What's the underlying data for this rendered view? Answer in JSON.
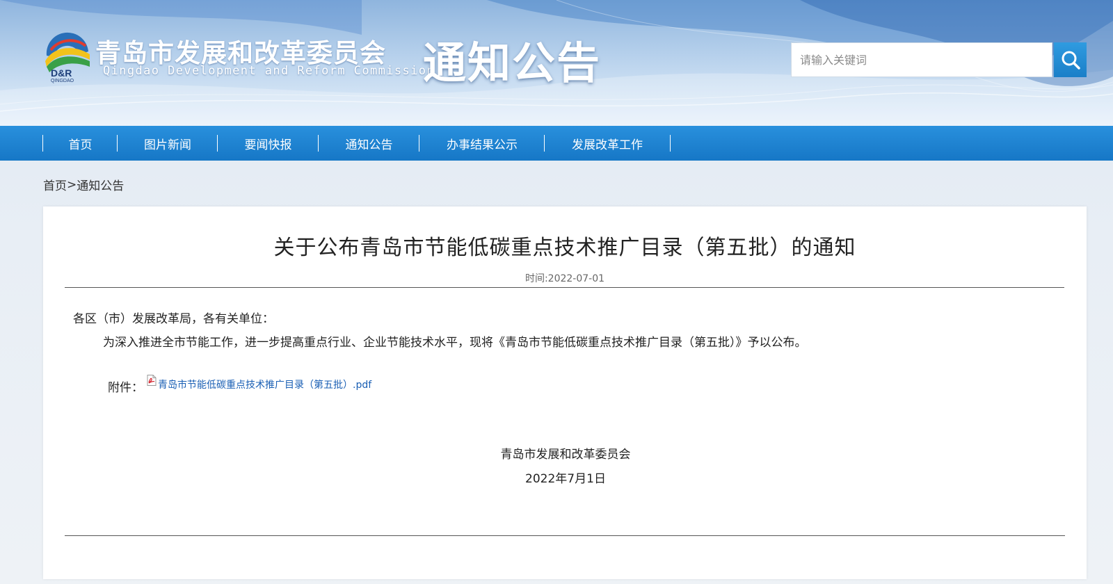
{
  "header": {
    "logo_cn": "青岛市发展和改革委员会",
    "logo_en": "Qingdao Development and Reform Commission",
    "logo_mark_text": "D&R",
    "logo_mark_subtext": "QINGDAO",
    "section_title": "通知公告",
    "search": {
      "placeholder": "请输入关键词",
      "icon": "search-icon"
    }
  },
  "nav": {
    "items": [
      {
        "label": "首页"
      },
      {
        "label": "图片新闻"
      },
      {
        "label": "要闻快报"
      },
      {
        "label": "通知公告"
      },
      {
        "label": "办事结果公示"
      },
      {
        "label": "发展改革工作"
      }
    ]
  },
  "breadcrumb": {
    "home": "首页",
    "separator": ">",
    "current": "通知公告"
  },
  "article": {
    "title": "关于公布青岛市节能低碳重点技术推广目录（第五批）的通知",
    "date": "时间:2022-07-01",
    "salutation": "各区（市）发展改革局，各有关单位：",
    "paragraph": "为深入推进全市节能工作，进一步提高重点行业、企业节能技术水平，现将《青岛市节能低碳重点技术推广目录（第五批）》予以公布。",
    "attachment_label": "附件：",
    "attachment_link": "青岛市节能低碳重点技术推广目录（第五批）.pdf",
    "attachment_icon": "pdf-icon",
    "signature_org": "青岛市发展和改革委员会",
    "signature_date": "2022年7月1日"
  },
  "colors": {
    "nav_blue": "#1d82cf",
    "search_button": "#1a7fc8",
    "link": "#1a5fb4"
  }
}
